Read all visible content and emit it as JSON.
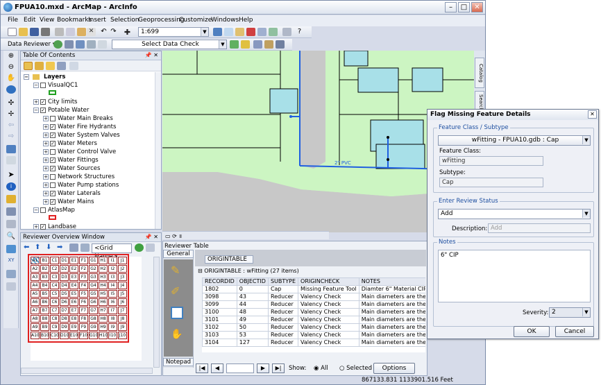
{
  "window": {
    "title": "FPUA10.mxd - ArcMap - ArcInfo",
    "minimize": "–",
    "maximize": "□",
    "close": "✕"
  },
  "menu": [
    "File",
    "Edit",
    "View",
    "Bookmarks",
    "Insert",
    "Selection",
    "Geoprocessing",
    "Customize",
    "Windows",
    "Help"
  ],
  "toolbar": {
    "scale": "1:699",
    "reviewer_label": "Data Reviewer ▾",
    "data_check": "Select Data Check"
  },
  "toc": {
    "title": "Table Of Contents",
    "layers_root": "Layers",
    "items": {
      "visualqc1": "VisualQC1",
      "city_limits": "City limits",
      "potable_water": "Potable Water",
      "water_main_breaks": "Water Main Breaks",
      "water_fire_hydrants": "Water Fire Hydrants",
      "water_system_valves": "Water System Valves",
      "water_meters": "Water Meters",
      "water_control_valve": "Water Control Valve",
      "water_fittings": "Water Fittings",
      "water_sources": "Water Sources",
      "network_structures": "Network Structures",
      "water_pump_stations": "Water Pump stations",
      "water_laterals": "Water Laterals",
      "water_mains": "Water Mains",
      "atlasmap": "AtlasMap",
      "landbase": "Landbase"
    }
  },
  "map": {
    "pipe_label": "2\" PVC"
  },
  "right_dock": {
    "catalog": "Catalog",
    "search": "Search"
  },
  "overview": {
    "title": "Reviewer Overview Window",
    "grid_name": "<Grid Name>",
    "columns": [
      "A",
      "B",
      "C",
      "D",
      "E",
      "F",
      "G",
      "H",
      "I",
      "J"
    ],
    "rows": [
      "1",
      "2",
      "3",
      "4",
      "5",
      "6",
      "7",
      "8",
      "9",
      "10"
    ]
  },
  "reviewer_table": {
    "title": "Reviewer Table",
    "tab_general": "General",
    "tab_notepad": "Notepad",
    "tab_origintable": "ORIGINTABLE",
    "group_label": "ORIGINTABLE : wFitting (27 items)",
    "columns": [
      "RECORDID",
      "OBJECTID",
      "SUBTYPE",
      "ORIGINCHECK",
      "NOTES"
    ],
    "rows": [
      [
        "1802",
        "0",
        "Cap",
        "Missing Feature Tool",
        "Diamter 6\" Material CIP"
      ],
      [
        "3098",
        "43",
        "Reducer",
        "Valency Check",
        "Main diameters are the"
      ],
      [
        "3099",
        "44",
        "Reducer",
        "Valency Check",
        "Main diameters are the"
      ],
      [
        "3100",
        "48",
        "Reducer",
        "Valency Check",
        "Main diameters are the"
      ],
      [
        "3101",
        "49",
        "Reducer",
        "Valency Check",
        "Main diameters are the"
      ],
      [
        "3102",
        "50",
        "Reducer",
        "Valency Check",
        "Main diameters are the"
      ],
      [
        "3103",
        "53",
        "Reducer",
        "Valency Check",
        "Main diameters are the"
      ],
      [
        "3104",
        "127",
        "Reducer",
        "Valency Check",
        "Main diameters are the same"
      ]
    ],
    "nav_first": "|◀",
    "nav_prev": "◀",
    "nav_next": "▶",
    "nav_last": "▶|",
    "show_label": "Show:",
    "show_all": "All",
    "show_selected": "Selected",
    "options_button": "Options"
  },
  "status": {
    "coords": "867133.831  1133901.516 Feet"
  },
  "dialog": {
    "title": "Flag Missing Feature Details",
    "close": "✕",
    "feature_class_group": "Feature Class / Subtype",
    "feature_class_select": "wFitting - FPUA10.gdb : Cap",
    "feature_class_label": "Feature Class:",
    "feature_class_value": "wFitting",
    "subtype_label": "Subtype:",
    "subtype_value": "Cap",
    "review_status_group": "Enter Review Status",
    "review_status_value": "Add",
    "description_label": "Description:",
    "description_value": "Add",
    "notes_group": "Notes",
    "notes_value": "6\" CIP",
    "severity_label": "Severity:",
    "severity_value": "2",
    "ok": "OK",
    "cancel": "Cancel"
  },
  "colors": {
    "map_bg": "#ccf5c2",
    "road": "#c8c8c8",
    "building": "#a8e0e8",
    "pipe": "#1f5fe0"
  }
}
